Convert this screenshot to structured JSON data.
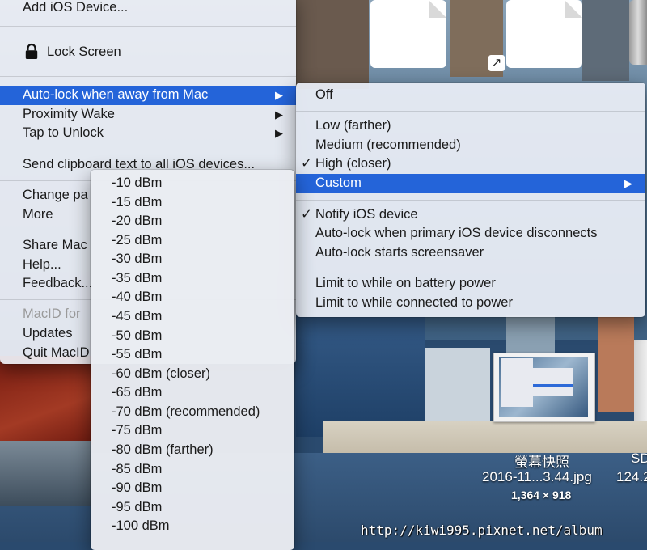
{
  "desktop": {
    "files": [
      {
        "name": "",
        "kind": "file"
      },
      {
        "name": "",
        "kind": "file-alias"
      }
    ],
    "screenshot_file": {
      "title": "螢幕快照",
      "filename": "2016-11...3.44.jpg",
      "dimensions": "1,364 × 918"
    },
    "partial_right_label": "SD",
    "partial_right_size": "124.2",
    "watermark": "http://kiwi995.pixnet.net/album"
  },
  "main_menu": {
    "items": [
      {
        "label": "Add iOS Device..."
      },
      {
        "label": "Lock Screen",
        "icon": "lock-icon"
      },
      {
        "label": "Auto-lock when away from Mac",
        "submenu": true,
        "highlighted": true
      },
      {
        "label": "Proximity Wake",
        "submenu": true
      },
      {
        "label": "Tap to Unlock",
        "submenu": true
      },
      {
        "label": "Send clipboard text to all iOS devices..."
      },
      {
        "label": "Change pa"
      },
      {
        "label": "More"
      },
      {
        "label": "Share Mac"
      },
      {
        "label": "Help..."
      },
      {
        "label": "Feedback..."
      },
      {
        "label": "MacID for",
        "disabled": true
      },
      {
        "label": "Updates"
      },
      {
        "label": "Quit MacID"
      }
    ]
  },
  "autolock_submenu": {
    "items": [
      {
        "label": "Off"
      },
      {
        "label": "Low (farther)"
      },
      {
        "label": "Medium (recommended)"
      },
      {
        "label": "High (closer)",
        "checked": true
      },
      {
        "label": "Custom",
        "submenu": true,
        "highlighted": true
      },
      {
        "label": "Notify iOS device",
        "checked": true
      },
      {
        "label": "Auto-lock when primary iOS device disconnects"
      },
      {
        "label": "Auto-lock starts screensaver"
      },
      {
        "label": "Limit to while on battery power"
      },
      {
        "label": "Limit to while connected to power"
      }
    ],
    "check_glyph": "✓",
    "arrow_glyph": "▶"
  },
  "custom_submenu": {
    "items": [
      {
        "label": "-10 dBm"
      },
      {
        "label": "-15 dBm"
      },
      {
        "label": "-20 dBm"
      },
      {
        "label": "-25 dBm"
      },
      {
        "label": "-30 dBm"
      },
      {
        "label": "-35 dBm"
      },
      {
        "label": "-40 dBm"
      },
      {
        "label": "-45 dBm"
      },
      {
        "label": "-50 dBm"
      },
      {
        "label": "-55 dBm"
      },
      {
        "label": "-60 dBm (closer)"
      },
      {
        "label": "-65 dBm"
      },
      {
        "label": "-70 dBm (recommended)"
      },
      {
        "label": "-75 dBm"
      },
      {
        "label": "-80 dBm (farther)"
      },
      {
        "label": "-85 dBm"
      },
      {
        "label": "-90 dBm"
      },
      {
        "label": "-95 dBm"
      },
      {
        "label": "-100 dBm"
      }
    ]
  },
  "colors": {
    "highlight": "#2464d9",
    "menu_text": "#1a1a1a",
    "disabled_text": "#9a9a9a"
  }
}
